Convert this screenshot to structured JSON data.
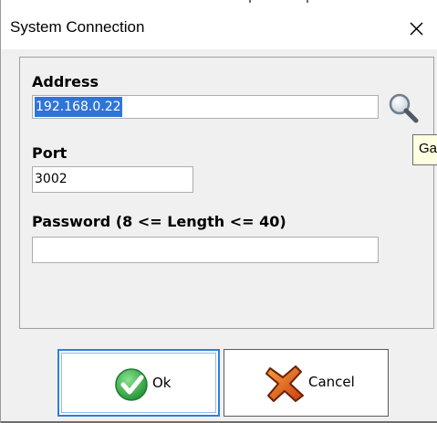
{
  "window": {
    "title": "System Connection"
  },
  "form": {
    "address_label": "Address",
    "address_value": "192.168.0.22",
    "port_label": "Port",
    "port_value": "3002",
    "password_label": "Password (8 <= Length <= 40)",
    "password_value": ""
  },
  "tooltip": {
    "text": "Gat"
  },
  "buttons": {
    "ok_label": "Ok",
    "cancel_label": "Cancel"
  },
  "icons": {
    "close": "close-icon",
    "search": "magnifier-icon",
    "ok": "check-icon",
    "cancel": "cancel-x-icon"
  },
  "colors": {
    "selection": "#3074d8",
    "focus_border": "#2f7fd8",
    "ok_green": "#3cb043",
    "cancel_orange": "#e8601c",
    "tooltip_bg": "#ffffe1"
  }
}
